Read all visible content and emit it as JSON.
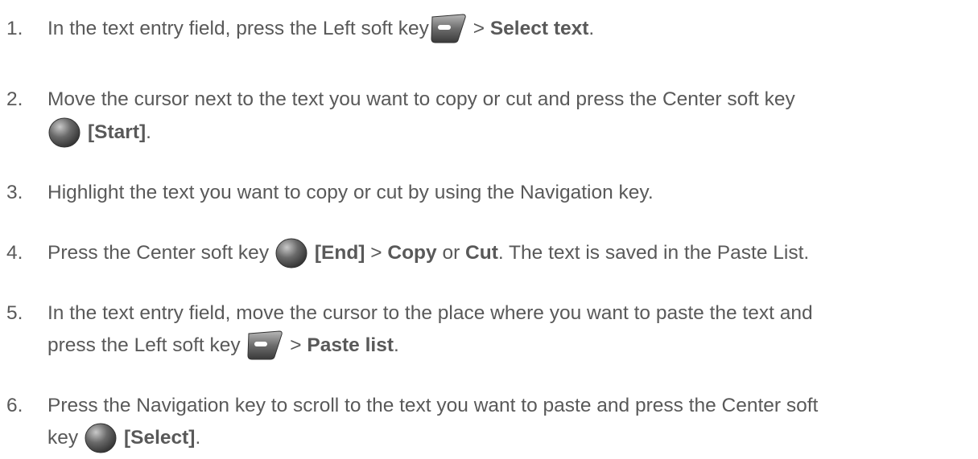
{
  "steps": [
    {
      "number": "1.",
      "t1": "In the text entry field, press the Left soft key ",
      "t2": " > ",
      "bold1": "Select text",
      "t3": "."
    },
    {
      "number": "2.",
      "t1": "Move the cursor next to the text you want to copy or cut and press the Center soft key",
      "bold1": "[Start]",
      "t2": "."
    },
    {
      "number": "3.",
      "t1": "Highlight the text you want to copy or cut by using the Navigation key."
    },
    {
      "number": "4.",
      "t1": "Press the Center soft key ",
      "bold1": "[End]",
      "t2": " > ",
      "bold2": "Copy",
      "t3": " or ",
      "bold3": "Cut",
      "t4": ". The text is saved in the Paste List."
    },
    {
      "number": "5.",
      "t1": "In the text entry field, move the cursor to the place where you want to paste the text and",
      "t2": "press the Left soft key ",
      "t3": " > ",
      "bold1": "Paste list",
      "t4": "."
    },
    {
      "number": "6.",
      "t1": "Press the Navigation key to scroll to the text you want to paste and press the Center soft",
      "t2": "key ",
      "bold1": "[Select]",
      "t3": "."
    }
  ],
  "icons": {
    "left_soft_key": "left-soft-key-icon",
    "center_soft_key": "center-soft-key-icon"
  }
}
